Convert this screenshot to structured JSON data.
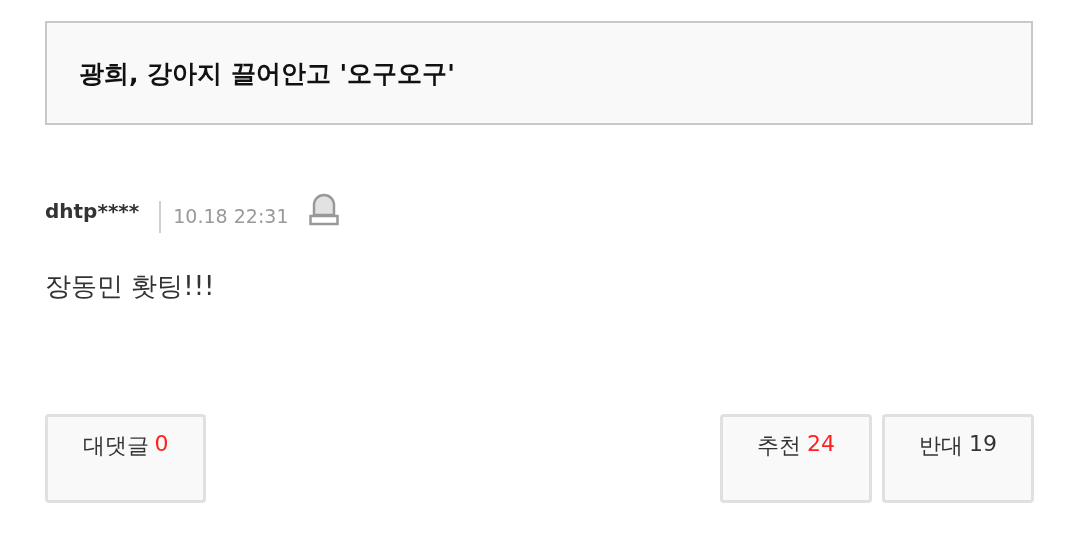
{
  "title": "광희, 강아지 끌어안고 '오구오구'",
  "comment": {
    "author": "dhtp****",
    "time": "10.18 22:31",
    "text": "장동민 홧팅!!!"
  },
  "buttons": [
    {
      "label": "대댓글",
      "count": "0",
      "color": "#ff2020"
    },
    {
      "label": "추천",
      "count": "24",
      "color": "#ff2020"
    },
    {
      "label": "반대",
      "count": "19",
      "color": "#333333"
    }
  ]
}
